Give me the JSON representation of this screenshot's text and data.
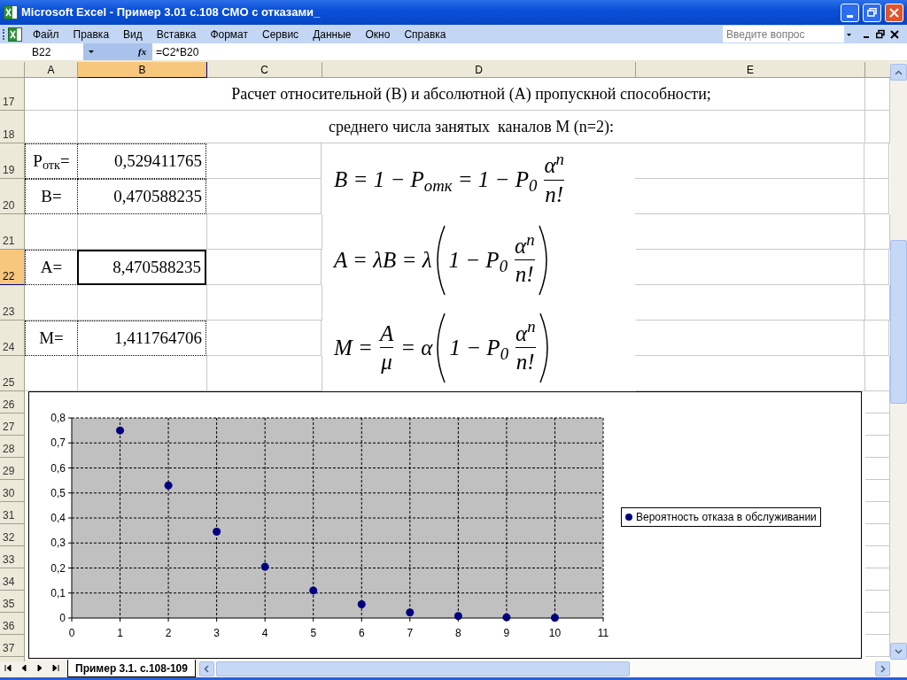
{
  "window": {
    "title": "Microsoft Excel - Пример 3.01 с.108 СМО с отказами_"
  },
  "menu": [
    {
      "label": "Файл"
    },
    {
      "label": "Правка"
    },
    {
      "label": "Вид"
    },
    {
      "label": "Вставка"
    },
    {
      "label": "Формат"
    },
    {
      "label": "Сервис"
    },
    {
      "label": "Данные"
    },
    {
      "label": "Окно"
    },
    {
      "label": "Справка"
    }
  ],
  "help_search": {
    "placeholder": "Введите вопрос"
  },
  "name_box": {
    "value": "B22"
  },
  "formula_bar": {
    "fx_label": "fx",
    "value": "=C2*B20"
  },
  "columns": [
    {
      "label": "A",
      "selected": false
    },
    {
      "label": "B",
      "selected": true
    },
    {
      "label": "C",
      "selected": false
    },
    {
      "label": "D",
      "selected": false
    },
    {
      "label": "E",
      "selected": false
    }
  ],
  "rows": [
    {
      "number": "17",
      "kind": "heading",
      "selected": false,
      "text": "Расчет относительной (В) и абсолютной (А) пропускной способности;"
    },
    {
      "number": "18",
      "kind": "heading",
      "selected": false,
      "text": "среднего числа занятых  каналов М (n=2):"
    },
    {
      "number": "19",
      "kind": "value",
      "selected": false,
      "label": "P$_{отк}$=",
      "value": "0,529411765"
    },
    {
      "number": "20",
      "kind": "value",
      "selected": false,
      "label": "B=",
      "value": "0,470588235"
    },
    {
      "number": "21",
      "kind": "blank",
      "selected": false
    },
    {
      "number": "22",
      "kind": "value",
      "selected": true,
      "label": "A=",
      "value": "8,470588235"
    },
    {
      "number": "23",
      "kind": "blank",
      "selected": false
    },
    {
      "number": "24",
      "kind": "value",
      "selected": false,
      "label": "M=",
      "value": "1,411764706"
    },
    {
      "number": "25",
      "kind": "blank",
      "selected": false
    }
  ],
  "chart_rows": [
    "26",
    "27",
    "28",
    "29",
    "30",
    "31",
    "32",
    "33",
    "34",
    "35",
    "36",
    "37"
  ],
  "equations": [
    [
      {
        "kind": "text",
        "s": "B = 1 − P$_{отк}$ = 1 − P$_{0}$"
      },
      {
        "kind": "frac",
        "num": "α$^{n}$",
        "den": "n!"
      }
    ],
    [
      {
        "kind": "text",
        "s": "A = λB = λ"
      },
      {
        "kind": "paren",
        "items": [
          {
            "kind": "text",
            "s": "1 − P$_{0}$"
          },
          {
            "kind": "frac",
            "num": "α$^{n}$",
            "den": "n!"
          }
        ]
      }
    ],
    [
      {
        "kind": "text",
        "s": "M ="
      },
      {
        "kind": "frac",
        "num": "A",
        "den": "μ"
      },
      {
        "kind": "text",
        "s": "= α"
      },
      {
        "kind": "paren",
        "items": [
          {
            "kind": "text",
            "s": "1 − P$_{0}$"
          },
          {
            "kind": "frac",
            "num": "α$^{n}$",
            "den": "n!"
          }
        ]
      }
    ]
  ],
  "chart": {
    "chart_data": {
      "type": "scatter",
      "x": [
        1,
        2,
        3,
        4,
        5,
        6,
        7,
        8,
        9,
        10
      ],
      "series": [
        {
          "name": "Вероятность отказа в обслуживании",
          "color": "#000080",
          "values": [
            0.75,
            0.53,
            0.345,
            0.205,
            0.11,
            0.055,
            0.022,
            0.008,
            0.003,
            0.001
          ]
        }
      ],
      "grid": true,
      "xlim": [
        0,
        11
      ],
      "ylim": [
        0,
        0.8
      ],
      "xticks": [
        0,
        1,
        2,
        3,
        4,
        5,
        6,
        7,
        8,
        9,
        10,
        11
      ],
      "yticks": [
        {
          "value": 0,
          "label": "0"
        },
        {
          "value": 0.1,
          "label": "0,1"
        },
        {
          "value": 0.2,
          "label": "0,2"
        },
        {
          "value": 0.3,
          "label": "0,3"
        },
        {
          "value": 0.4,
          "label": "0,4"
        },
        {
          "value": 0.5,
          "label": "0,5"
        },
        {
          "value": 0.6,
          "label": "0,6"
        },
        {
          "value": 0.7,
          "label": "0,7"
        },
        {
          "value": 0.8,
          "label": "0,8"
        }
      ]
    }
  },
  "sheet_tabs": [
    {
      "label": "Пример 3.1. с.108-109",
      "selected": true
    }
  ]
}
